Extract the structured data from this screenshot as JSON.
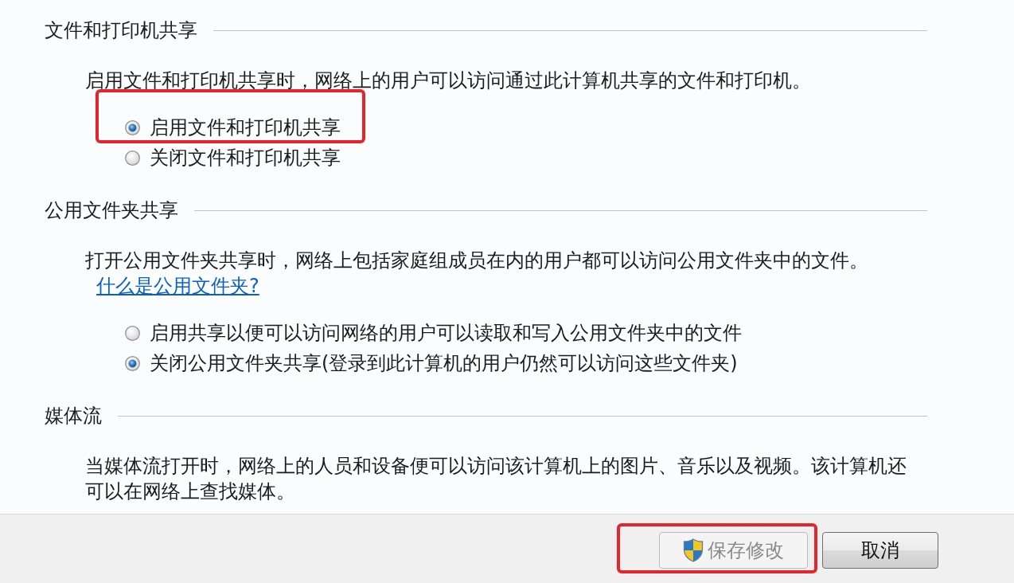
{
  "sections": [
    {
      "heading": "文件和打印机共享",
      "description": "启用文件和打印机共享时，网络上的用户可以访问通过此计算机共享的文件和打印机。",
      "options": [
        {
          "label": "启用文件和打印机共享",
          "selected": true,
          "highlighted": true
        },
        {
          "label": "关闭文件和打印机共享",
          "selected": false,
          "highlighted": false
        }
      ]
    },
    {
      "heading": "公用文件夹共享",
      "description": "打开公用文件夹共享时，网络上包括家庭组成员在内的用户都可以访问公用文件夹中的文件。",
      "link": "什么是公用文件夹?",
      "options": [
        {
          "label": "启用共享以便可以访问网络的用户可以读取和写入公用文件夹中的文件",
          "selected": false,
          "highlighted": false
        },
        {
          "label": "关闭公用文件夹共享(登录到此计算机的用户仍然可以访问这些文件夹)",
          "selected": true,
          "highlighted": false
        }
      ]
    },
    {
      "heading": "媒体流",
      "description": "当媒体流打开时，网络上的人员和设备便可以访问该计算机上的图片、音乐以及视频。该计算机还可以在网络上查找媒体。"
    }
  ],
  "buttons": [
    {
      "label": "保存修改",
      "kind": "shield",
      "disabled": true,
      "highlighted": true
    },
    {
      "label": "取消",
      "kind": "plain",
      "disabled": false,
      "highlighted": false
    }
  ]
}
